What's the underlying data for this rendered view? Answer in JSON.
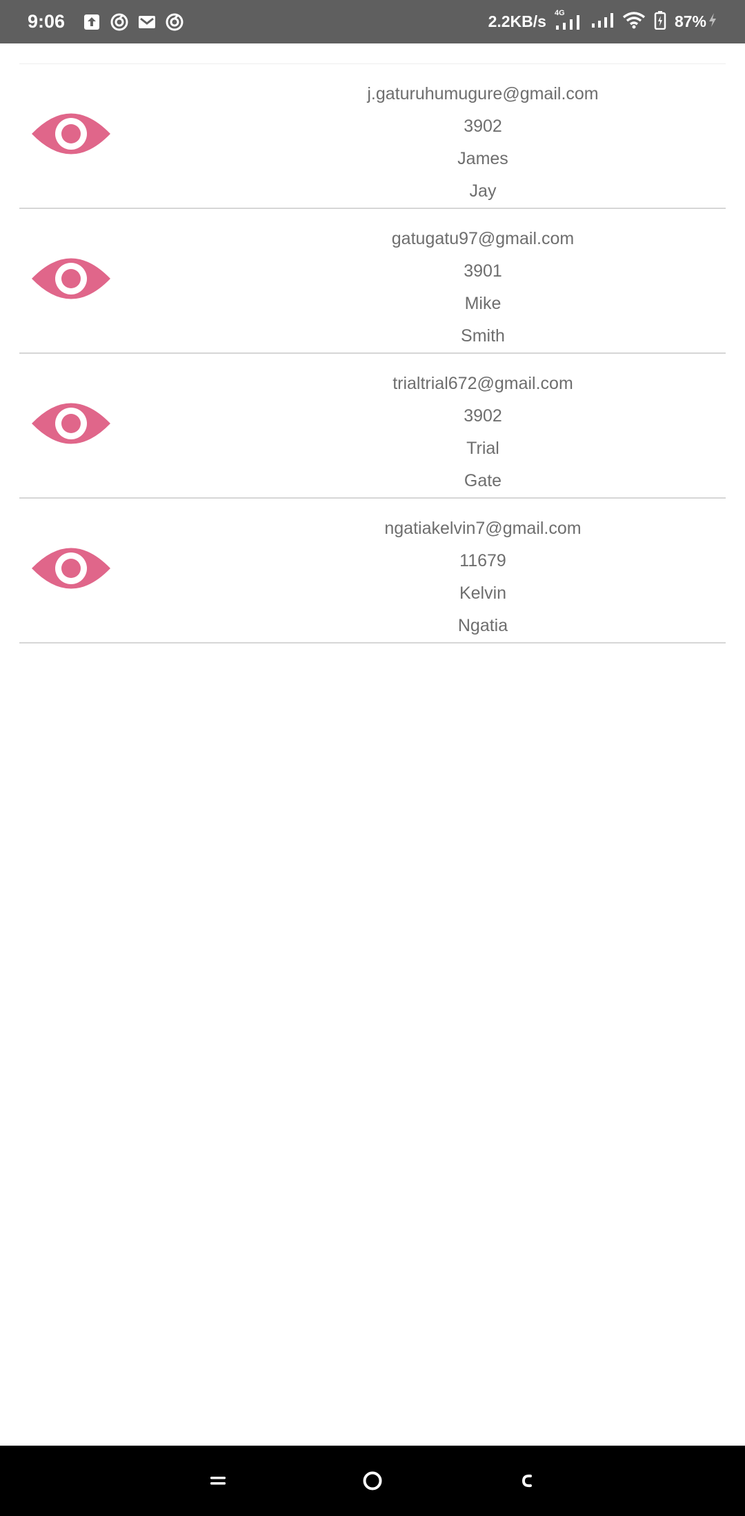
{
  "status_bar": {
    "time": "9:06",
    "net_speed": "2.2KB/s",
    "network_type": "4G",
    "battery": "87%",
    "left_icons": [
      "upload-icon",
      "app-notification-icon",
      "gmail-icon",
      "app-notification-icon"
    ],
    "right_icons": [
      "signal-icon",
      "signal-icon",
      "wifi-icon",
      "battery-icon",
      "charging-icon"
    ]
  },
  "accent_color": "#e0668a",
  "users": [
    {
      "email": "j.gaturuhumugure@gmail.com",
      "code": "3902",
      "first_name": "James",
      "last_name": "Jay"
    },
    {
      "email": "gatugatu97@gmail.com",
      "code": "3901",
      "first_name": "Mike",
      "last_name": "Smith"
    },
    {
      "email": "trialtrial672@gmail.com",
      "code": "3902",
      "first_name": "Trial",
      "last_name": "Gate"
    },
    {
      "email": "ngatiakelvin7@gmail.com",
      "code": "11679",
      "first_name": "Kelvin",
      "last_name": "Ngatia"
    }
  ],
  "nav_bar": {
    "buttons": [
      "recents-button",
      "home-button",
      "back-button"
    ]
  }
}
